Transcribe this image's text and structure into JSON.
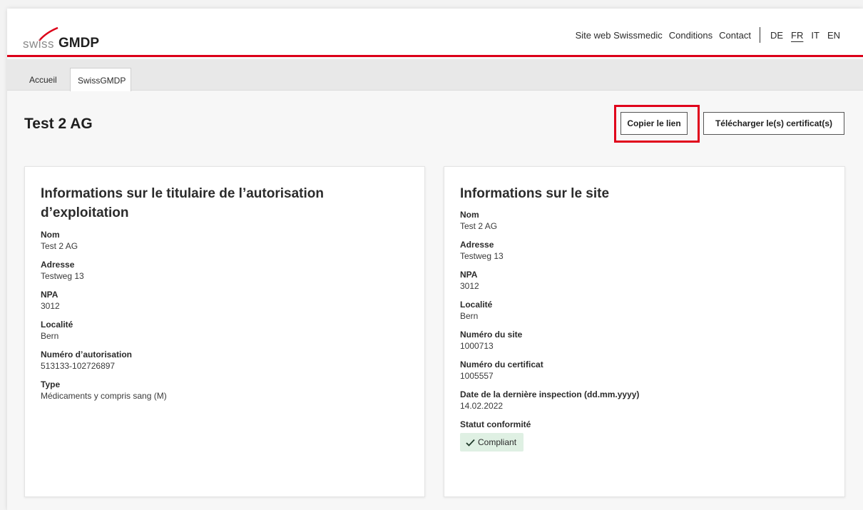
{
  "logo": {
    "swiss": "swiss",
    "gmdp": "GMDP"
  },
  "topnav": {
    "links": [
      "Site web Swissmedic",
      "Conditions",
      "Contact"
    ],
    "languages": [
      "DE",
      "FR",
      "IT",
      "EN"
    ],
    "active_language": "FR"
  },
  "tabs": [
    {
      "label": "Accueil",
      "active": false
    },
    {
      "label": "SwissGMDP",
      "active": true
    }
  ],
  "page": {
    "title": "Test 2 AG",
    "copy_link_label": "Copier le lien",
    "download_label": "Télécharger le(s) certificat(s)"
  },
  "holder_card": {
    "title": "Informations sur le titulaire de l’autorisation d’exploitation",
    "fields": [
      {
        "label": "Nom",
        "value": "Test 2 AG"
      },
      {
        "label": "Adresse",
        "value": "Testweg 13"
      },
      {
        "label": "NPA",
        "value": "3012"
      },
      {
        "label": "Localité",
        "value": "Bern"
      },
      {
        "label": "Numéro d’autorisation",
        "value": "513133-102726897"
      },
      {
        "label": "Type",
        "value": "Médicaments y compris sang (M)"
      }
    ]
  },
  "site_card": {
    "title": "Informations sur le site",
    "fields": [
      {
        "label": "Nom",
        "value": "Test 2 AG"
      },
      {
        "label": "Adresse",
        "value": "Testweg 13"
      },
      {
        "label": "NPA",
        "value": "3012"
      },
      {
        "label": "Localité",
        "value": "Bern"
      },
      {
        "label": "Numéro du site",
        "value": "1000713"
      },
      {
        "label": "Numéro du certificat",
        "value": "1005557"
      },
      {
        "label": "Date de la dernière inspection (dd.mm.yyyy)",
        "value": "14.02.2022"
      }
    ],
    "status_label": "Statut conformité",
    "status_badge": "Compliant"
  },
  "colors": {
    "brand_red": "#dc0018",
    "compliant_bg": "#dff0e3",
    "compliant_check": "#1f7a3a"
  },
  "icons": {
    "badge": "checkmark-icon",
    "logo": "swoosh-icon"
  }
}
